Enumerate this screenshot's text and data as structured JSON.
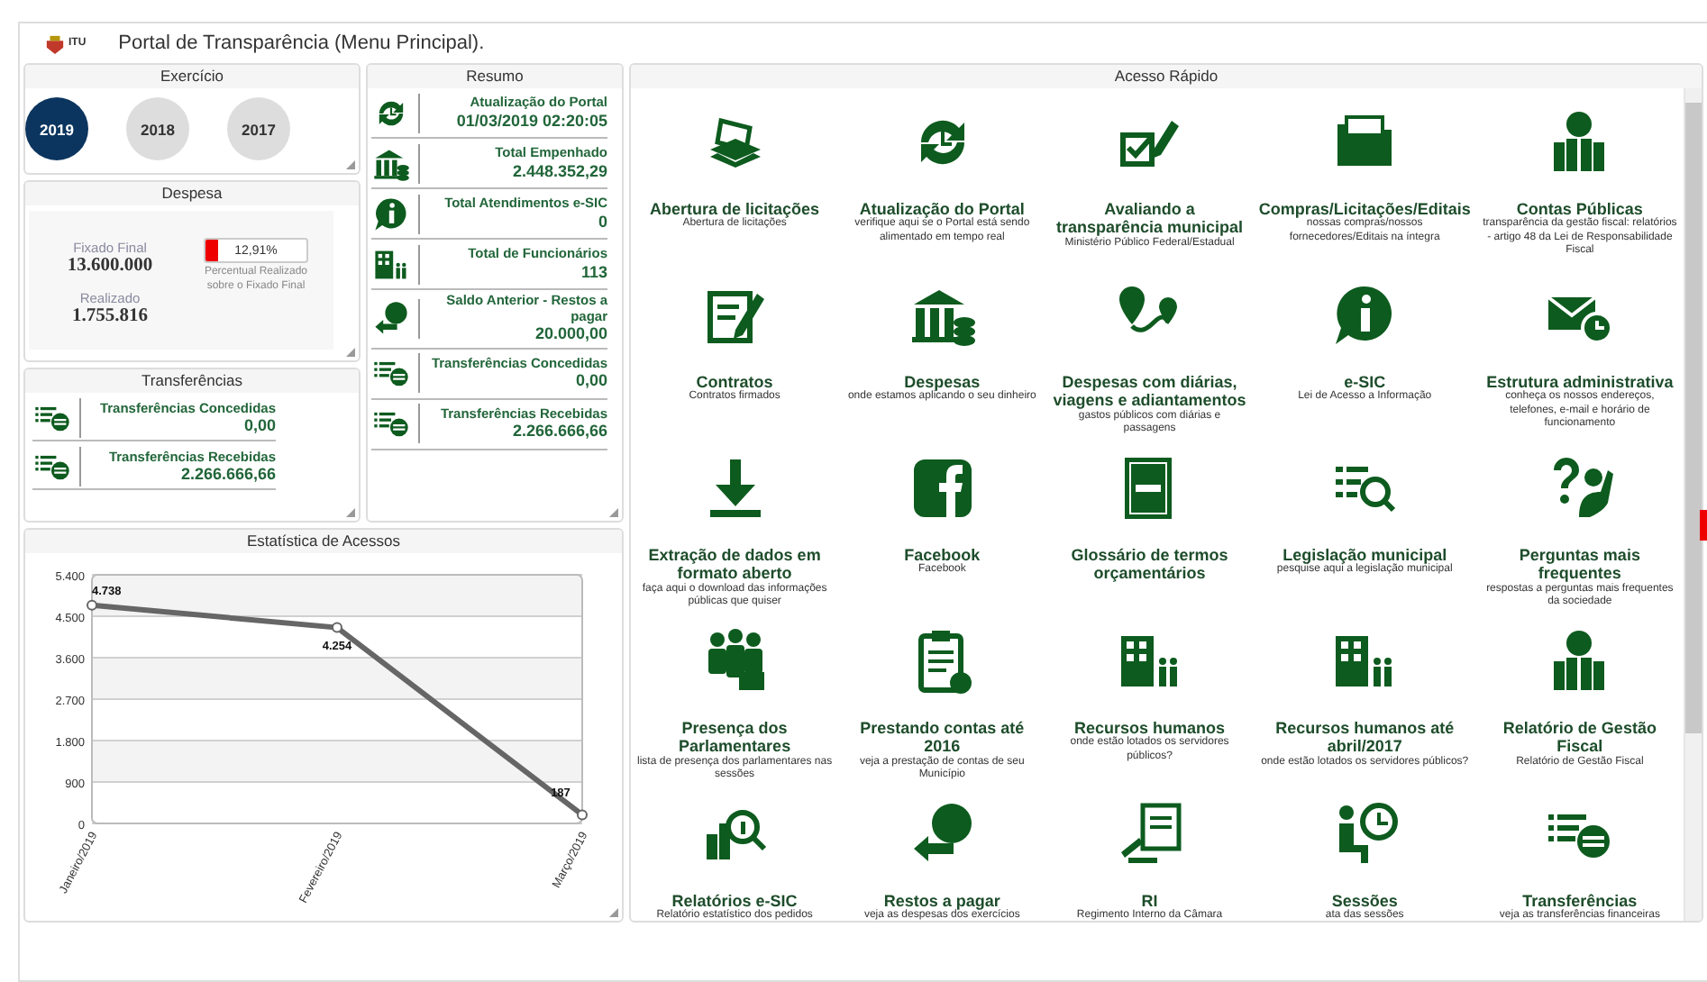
{
  "header": {
    "logo_text": "ITU",
    "title": "Portal de Transparência (Menu Principal)."
  },
  "exercicio": {
    "title": "Exercício",
    "years": [
      {
        "label": "2019",
        "selected": true
      },
      {
        "label": "2018",
        "selected": false
      },
      {
        "label": "2017",
        "selected": false
      }
    ]
  },
  "despesa": {
    "title": "Despesa",
    "fixado_label": "Fixado Final",
    "fixado_value": "13.600.000",
    "realizado_label": "Realizado",
    "realizado_value": "1.755.816",
    "level": 0.1291,
    "reading": "12,91%",
    "caption": "Percentual Realizado sobre o Fixado Final"
  },
  "transferencias": {
    "title": "Transferências",
    "items": [
      {
        "title": "Transferências Concedidas",
        "value": "0,00"
      },
      {
        "title": "Transferências Recebidas",
        "value": "2.266.666,66"
      }
    ]
  },
  "resumo": {
    "title": "Resumo",
    "items": [
      {
        "title": "Atualização do Portal",
        "value": "01/03/2019 02:20:05"
      },
      {
        "title": "Total Empenhado",
        "value": "2.448.352,29"
      },
      {
        "title": "Total Atendimentos e-SIC",
        "value": "0"
      },
      {
        "title": "Total de Funcionários",
        "value": "113"
      },
      {
        "title": "Saldo Anterior - Restos a pagar",
        "value": "20.000,00"
      },
      {
        "title": "Transferências Concedidas",
        "value": "0,00"
      },
      {
        "title": "Transferências Recebidas",
        "value": "2.266.666,66"
      }
    ]
  },
  "estatistica": {
    "title": "Estatística de Acessos",
    "chart_data": {
      "type": "line",
      "categories": [
        "Janeiro/2019",
        "Fevereiro/2019",
        "Março/2019"
      ],
      "series": [
        {
          "color": "#666666",
          "marker": true,
          "values": [
            4738,
            4254,
            187
          ]
        }
      ],
      "ylim": [
        0,
        5400
      ],
      "yticks": [
        {
          "value": 0,
          "label": "0"
        },
        {
          "value": 900,
          "label": "900"
        },
        {
          "value": 1800,
          "label": "1.800"
        },
        {
          "value": 2700,
          "label": "2.700"
        },
        {
          "value": 3600,
          "label": "3.600"
        },
        {
          "value": 4500,
          "label": "4.500"
        },
        {
          "value": 5400,
          "label": "5.400"
        }
      ],
      "grid": true,
      "value_labels": [
        "4.738",
        "4.254",
        "187"
      ]
    }
  },
  "acesso_rapido": {
    "title": "Acesso Rápido",
    "tiles": [
      {
        "title": "Abertura de licitações",
        "description": "Abertura de licitações"
      },
      {
        "title": "Atualização do Portal",
        "description": "verifique aqui se o Portal está sendo alimentado em tempo real"
      },
      {
        "title": "Avaliando a transparência municipal",
        "description": "Ministério Público Federal/Estadual"
      },
      {
        "title": "Compras/Licitações/Editais",
        "description": "nossas compras/nossos fornecedores/Editais na íntegra"
      },
      {
        "title": "Contas Públicas",
        "description": "transparência da gestão fiscal: relatórios - artigo 48 da Lei de Responsabilidade Fiscal"
      },
      {
        "title": "Contratos",
        "description": "Contratos firmados"
      },
      {
        "title": "Despesas",
        "description": "onde estamos aplicando o seu dinheiro"
      },
      {
        "title": "Despesas com diárias, viagens e adiantamentos",
        "description": "gastos públicos com diárias e passagens"
      },
      {
        "title": "e-SIC",
        "description": "Lei de Acesso a Informação"
      },
      {
        "title": "Estrutura administrativa",
        "description": "conheça os nossos endereços, telefones, e-mail e horário de funcionamento"
      },
      {
        "title": "Extração de dados em formato aberto",
        "description": "faça aqui o download das informações públicas que quiser"
      },
      {
        "title": "Facebook",
        "description": "Facebook"
      },
      {
        "title": "Glossário de termos orçamentários"
      },
      {
        "title": "Legislação municipal",
        "description": "pesquise aqui a legislação municipal"
      },
      {
        "title": "Perguntas mais frequentes",
        "description": "respostas a perguntas mais frequentes da sociedade"
      },
      {
        "title": "Presença dos Parlamentares",
        "description": "lista de presença dos parlamentares nas sessões"
      },
      {
        "title": "Prestando contas até 2016",
        "description": "veja a prestação de contas de seu Município"
      },
      {
        "title": "Recursos humanos",
        "description": "onde estão lotados os servidores públicos?"
      },
      {
        "title": "Recursos humanos até abril/2017",
        "description": "onde estão lotados os servidores públicos?"
      },
      {
        "title": "Relatório de Gestão Fiscal",
        "description": "Relatório de Gestão Fiscal"
      },
      {
        "title": "Relatórios e-SIC",
        "description": "Relatório estatístico dos pedidos"
      },
      {
        "title": "Restos a pagar",
        "description": "veja as despesas dos exercícios"
      },
      {
        "title": "RI",
        "description": "Regimento Interno da Câmara"
      },
      {
        "title": "Sessões",
        "description": "ata das sessões"
      },
      {
        "title": "Transferências",
        "description": "veja as transferências financeiras"
      }
    ]
  }
}
